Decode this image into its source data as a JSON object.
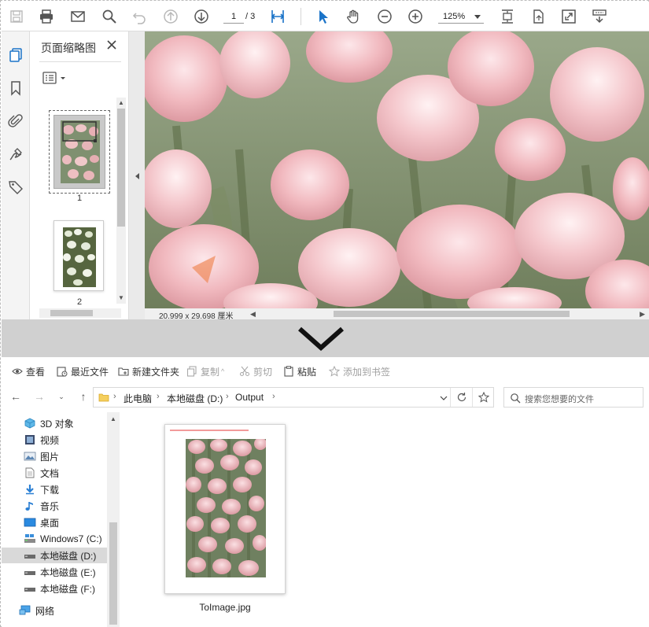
{
  "pdf_viewer": {
    "page_input": "1",
    "page_total": "/ 3",
    "zoom": "125%",
    "panel": {
      "title": "页面缩略图",
      "thumbnails": [
        {
          "label": "1"
        },
        {
          "label": "2"
        }
      ]
    },
    "status_dimensions": "20.999 x 29.698 厘米"
  },
  "explorer": {
    "ribbon": [
      {
        "label": "查看",
        "icon": "eye-icon",
        "enabled": true
      },
      {
        "label": "最近文件",
        "icon": "recent-files-icon",
        "enabled": true
      },
      {
        "label": "新建文件夹",
        "icon": "new-folder-icon",
        "enabled": true
      },
      {
        "label": "复制",
        "icon": "copy-icon",
        "enabled": false
      },
      {
        "label": "剪切",
        "icon": "cut-icon",
        "enabled": false
      },
      {
        "label": "粘贴",
        "icon": "paste-icon",
        "enabled": true
      },
      {
        "label": "添加到书签",
        "icon": "bookmark-star-icon",
        "enabled": false
      }
    ],
    "breadcrumb": [
      "此电脑",
      "本地磁盘 (D:)",
      "Output"
    ],
    "search_placeholder": "搜索您想要的文件",
    "nav_items": [
      {
        "label": "3D 对象",
        "icon": "3d-objects-icon"
      },
      {
        "label": "视频",
        "icon": "video-icon"
      },
      {
        "label": "图片",
        "icon": "pictures-icon"
      },
      {
        "label": "文档",
        "icon": "documents-icon"
      },
      {
        "label": "下载",
        "icon": "downloads-icon"
      },
      {
        "label": "音乐",
        "icon": "music-icon"
      },
      {
        "label": "桌面",
        "icon": "desktop-icon"
      },
      {
        "label": "Windows7 (C:)",
        "icon": "system-drive-icon"
      },
      {
        "label": "本地磁盘 (D:)",
        "icon": "drive-icon",
        "selected": true
      },
      {
        "label": "本地磁盘 (E:)",
        "icon": "drive-icon"
      },
      {
        "label": "本地磁盘 (F:)",
        "icon": "drive-icon"
      },
      {
        "label": "网络",
        "icon": "network-icon"
      }
    ],
    "file": {
      "name": "ToImage.jpg"
    }
  },
  "colors": {
    "accent": "#1a73c8",
    "selection": "#d9d9d9",
    "band": "#d0d0d0"
  }
}
